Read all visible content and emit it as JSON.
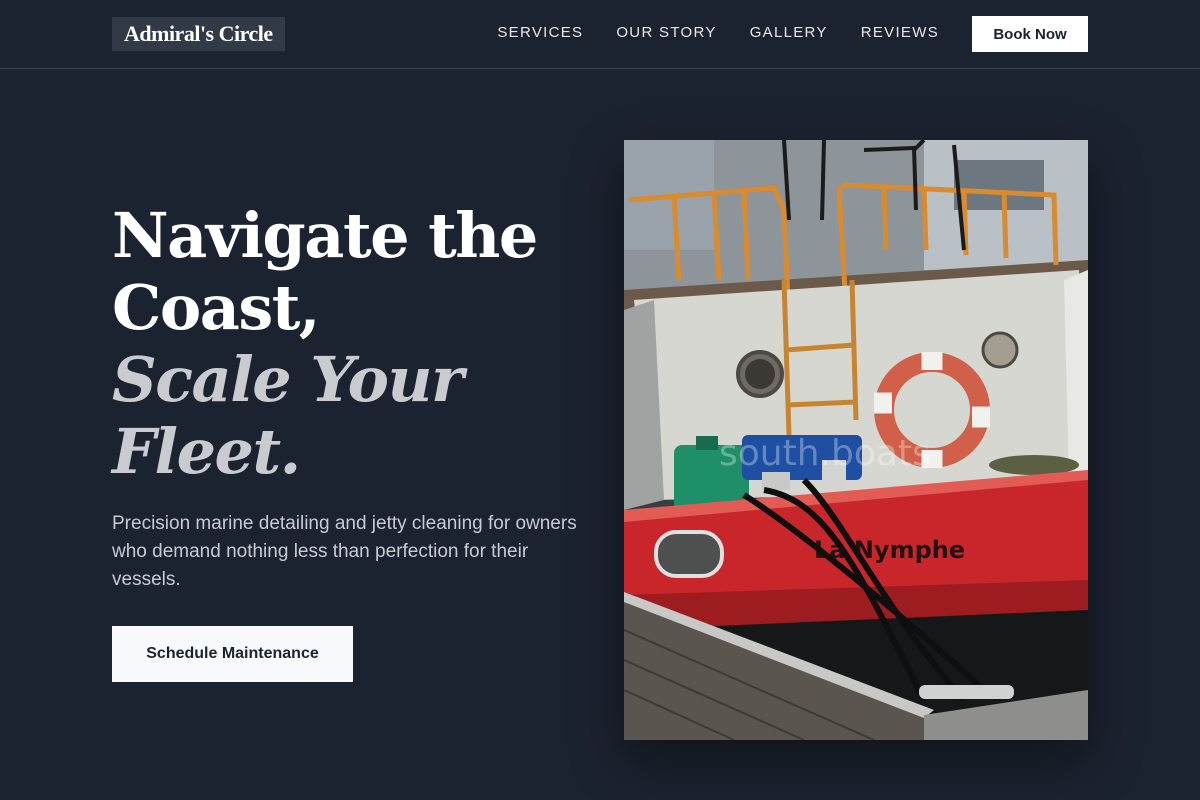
{
  "brand": {
    "name": "Admiral's Circle"
  },
  "nav": {
    "links": [
      "SERVICES",
      "OUR STORY",
      "GALLERY",
      "REVIEWS"
    ],
    "book_label": "Book Now"
  },
  "hero": {
    "title_line1": "Navigate the",
    "title_line2": "Coast,",
    "title_line3": "Scale Your",
    "title_line4": "Fleet.",
    "description": "Precision marine detailing and jetty cleaning for owners who demand nothing less than perfection for their vessels.",
    "cta_label": "Schedule Maintenance"
  },
  "photo": {
    "boat_name": "La Nymphe",
    "watermark": "south.boats"
  },
  "colors": {
    "background": "#1c2330",
    "accent_light": "#f8f9fb",
    "hull_red": "#c8262b"
  }
}
